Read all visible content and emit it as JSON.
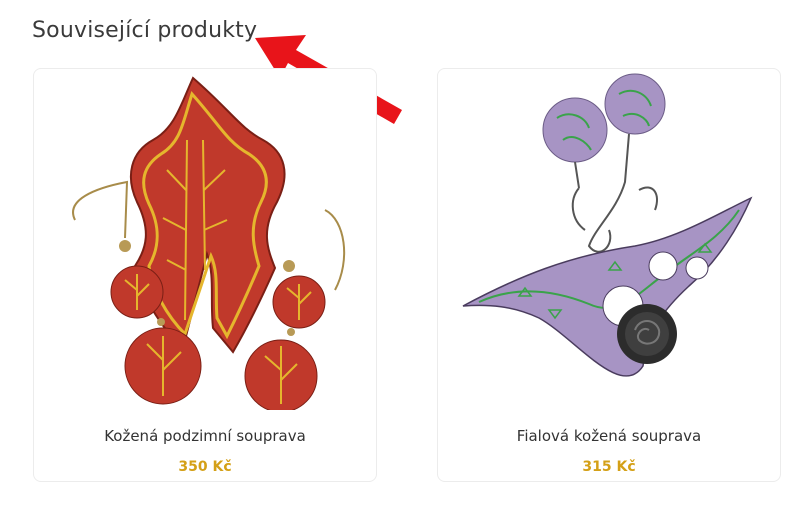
{
  "section": {
    "title": "Související produkty"
  },
  "annotation": {
    "arrow_color": "#e8141a"
  },
  "products": [
    {
      "name": "Kožená podzimní souprava",
      "price": "350 Kč",
      "image_icon": "red-leaf-earrings-image"
    },
    {
      "name": "Fialová kožená souprava",
      "price": "315 Kč",
      "image_icon": "purple-leather-earrings-image"
    }
  ],
  "colors": {
    "price": "#d4a017",
    "card_border": "#ececec"
  }
}
